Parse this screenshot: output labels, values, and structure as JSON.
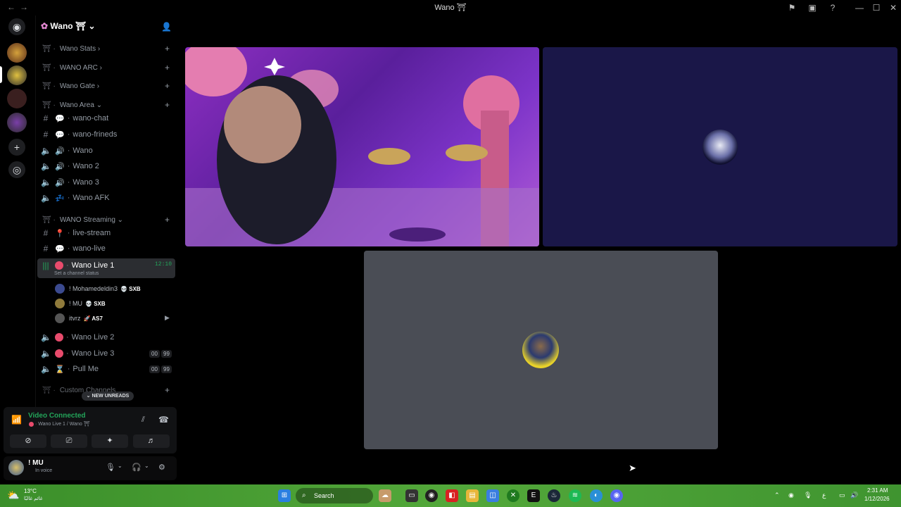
{
  "window": {
    "title": "Wano ⛩",
    "nav_back": "←",
    "nav_fwd": "→",
    "minimize": "—",
    "maximize": "☐",
    "close": "✕"
  },
  "server": {
    "name": "Wano ⛩"
  },
  "categories": [
    {
      "label": "Wano Stats"
    },
    {
      "label": "WANO ARC"
    },
    {
      "label": "Wano Gate"
    },
    {
      "label": "Wano Area"
    },
    {
      "label": "WANO Streaming"
    },
    {
      "label": "Custom Channels"
    }
  ],
  "channels": [
    {
      "label": "wano-chat",
      "type": "text"
    },
    {
      "label": "wano-frineds",
      "type": "text"
    },
    {
      "label": "Wano",
      "type": "voice"
    },
    {
      "label": "Wano 2",
      "type": "voice"
    },
    {
      "label": "Wano 3",
      "type": "voice"
    },
    {
      "label": "Wano AFK",
      "type": "voice"
    },
    {
      "label": "live-stream",
      "type": "text"
    },
    {
      "label": "wano-live",
      "type": "text"
    },
    {
      "label": "Wano Live 1",
      "type": "voice",
      "timer": "12:10",
      "status": "Set a channel status"
    },
    {
      "label": "Wano Live 2",
      "type": "voice"
    },
    {
      "label": "Wano Live 3",
      "type": "voice",
      "badges": [
        "00",
        "99"
      ]
    },
    {
      "label": "Pull Me",
      "type": "voice",
      "badges": [
        "00",
        "99"
      ]
    }
  ],
  "voice_users": [
    {
      "name": "! Mohamedeldin3",
      "tag": "SXB"
    },
    {
      "name": "! MU",
      "tag": "SXB"
    },
    {
      "name": "itvrz",
      "tag": "AS7"
    }
  ],
  "new_unreads": "NEW UNREADS",
  "voice_panel": {
    "status": "Video Connected",
    "location": "Wano Live 1 / Wano ⛩"
  },
  "user_panel": {
    "name": "! MU",
    "state": "In voice"
  },
  "taskbar": {
    "weather_temp": "13°C",
    "weather_desc": "غائم غالبًا",
    "search": "Search",
    "time": "2:31 AM",
    "date": "1/12/2026",
    "lang": "ع"
  },
  "colors": {
    "accent_green": "#23a55a",
    "bg": "#000000",
    "panel": "#111214",
    "tile_gray": "#4a4d55",
    "tile_navy": "#1a1748"
  }
}
